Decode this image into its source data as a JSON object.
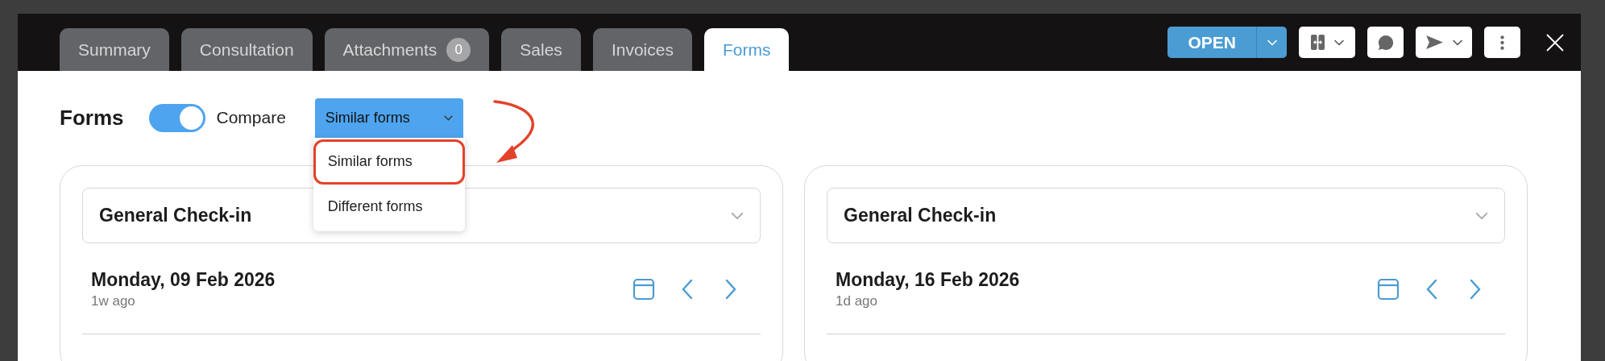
{
  "tabs": [
    {
      "label": "Summary",
      "selected": false
    },
    {
      "label": "Consultation",
      "selected": false
    },
    {
      "label": "Attachments",
      "badge": "0",
      "selected": false
    },
    {
      "label": "Sales",
      "selected": false
    },
    {
      "label": "Invoices",
      "selected": false
    },
    {
      "label": "Forms",
      "selected": true
    }
  ],
  "status_button": {
    "label": "OPEN"
  },
  "page": {
    "title": "Forms",
    "compare_toggle": {
      "label": "Compare",
      "on": true
    },
    "form_filter": {
      "value": "Similar forms",
      "expanded": true,
      "options": [
        {
          "label": "Similar forms",
          "highlighted": true
        },
        {
          "label": "Different forms",
          "highlighted": false
        }
      ]
    }
  },
  "panels": [
    {
      "form_name": "General Check-in",
      "date": "Monday, 09 Feb 2026",
      "relative_time": "1w ago"
    },
    {
      "form_name": "General Check-in",
      "date": "Monday, 16 Feb 2026",
      "relative_time": "1d ago"
    }
  ]
}
